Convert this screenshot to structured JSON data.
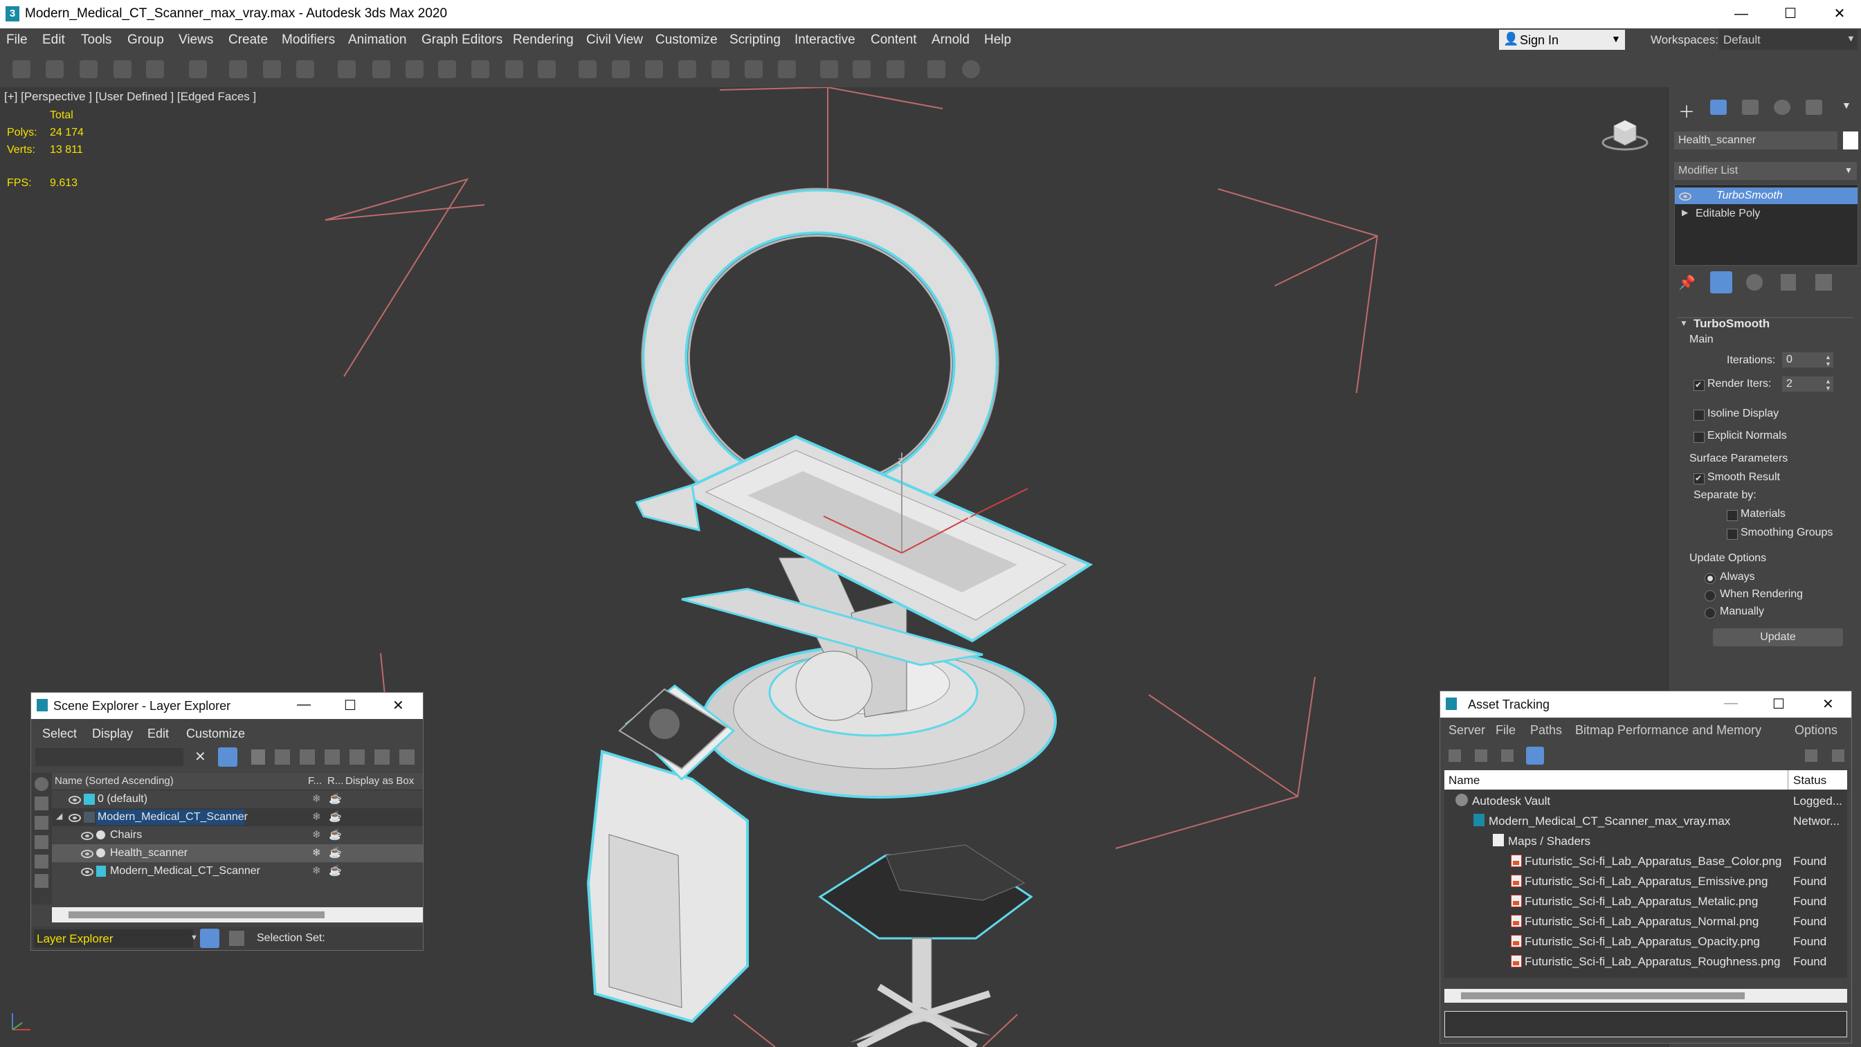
{
  "window": {
    "title": "Modern_Medical_CT_Scanner_max_vray.max - Autodesk 3ds Max 2020",
    "app_icon": "3"
  },
  "menu": [
    "File",
    "Edit",
    "Tools",
    "Group",
    "Views",
    "Create",
    "Modifiers",
    "Animation",
    "Graph Editors",
    "Rendering",
    "Civil View",
    "Customize",
    "Scripting",
    "Interactive",
    "Content",
    "Arnold",
    "Help"
  ],
  "signin": {
    "label": "Sign In"
  },
  "workspace": {
    "label": "Workspaces:",
    "value": "Default"
  },
  "viewport": {
    "label": "[+] [Perspective ] [User Defined ] [Edged Faces ]",
    "stats": {
      "total_label": "Total",
      "polys_label": "Polys:",
      "polys_value": "24 174",
      "verts_label": "Verts:",
      "verts_value": "13 811",
      "fps_label": "FPS:",
      "fps_value": "9.613"
    },
    "axis_label_z": "z",
    "axis_label_x": "x"
  },
  "command_panel": {
    "object_name": "Health_scanner",
    "modifier_list_label": "Modifier List",
    "stack": [
      {
        "label": "TurboSmooth",
        "selected": true
      },
      {
        "label": "Editable Poly",
        "selected": false
      }
    ],
    "rollout_title": "TurboSmooth",
    "main_label": "Main",
    "iterations_label": "Iterations:",
    "iterations_value": "0",
    "render_iters_label": "Render Iters:",
    "render_iters_value": "2",
    "isoline_label": "Isoline Display",
    "explicit_normals_label": "Explicit Normals",
    "surface_params_label": "Surface Parameters",
    "smooth_result_label": "Smooth Result",
    "separate_by_label": "Separate by:",
    "materials_label": "Materials",
    "smoothing_groups_label": "Smoothing Groups",
    "update_options_label": "Update Options",
    "always_label": "Always",
    "when_rendering_label": "When Rendering",
    "manually_label": "Manually",
    "update_button": "Update"
  },
  "scene_explorer": {
    "title": "Scene Explorer - Layer Explorer",
    "menu": [
      "Select",
      "Display",
      "Edit",
      "Customize"
    ],
    "columns": {
      "name": "Name (Sorted Ascending)",
      "f": "F...",
      "r": "R...",
      "box": "Display as Box"
    },
    "rows": [
      {
        "label": "0 (default)",
        "indent": 0
      },
      {
        "label": "Modern_Medical_CT_Scanner",
        "indent": 0
      },
      {
        "label": "Chairs",
        "indent": 1
      },
      {
        "label": "Health_scanner",
        "indent": 1
      },
      {
        "label": "Modern_Medical_CT_Scanner",
        "indent": 1
      }
    ],
    "footer_dropdown": "Layer Explorer",
    "selection_set_label": "Selection Set:"
  },
  "asset_tracking": {
    "title": "Asset Tracking",
    "menu": [
      "Server",
      "File",
      "Paths",
      "Bitmap Performance and Memory",
      "Options"
    ],
    "columns": {
      "name": "Name",
      "status": "Status"
    },
    "rows": [
      {
        "name": "Autodesk Vault",
        "status": "Logged...",
        "indent": 0
      },
      {
        "name": "Modern_Medical_CT_Scanner_max_vray.max",
        "status": "Networ...",
        "indent": 1
      },
      {
        "name": "Maps / Shaders",
        "status": "",
        "indent": 2
      },
      {
        "name": "Futuristic_Sci-fi_Lab_Apparatus_Base_Color.png",
        "status": "Found",
        "indent": 3
      },
      {
        "name": "Futuristic_Sci-fi_Lab_Apparatus_Emissive.png",
        "status": "Found",
        "indent": 3
      },
      {
        "name": "Futuristic_Sci-fi_Lab_Apparatus_Metalic.png",
        "status": "Found",
        "indent": 3
      },
      {
        "name": "Futuristic_Sci-fi_Lab_Apparatus_Normal.png",
        "status": "Found",
        "indent": 3
      },
      {
        "name": "Futuristic_Sci-fi_Lab_Apparatus_Opacity.png",
        "status": "Found",
        "indent": 3
      },
      {
        "name": "Futuristic_Sci-fi_Lab_Apparatus_Roughness.png",
        "status": "Found",
        "indent": 3
      }
    ]
  },
  "colors": {
    "accent": "#5b8fd6",
    "selection_outline": "#5fd8ea",
    "stats_yellow": "#f3e000"
  }
}
